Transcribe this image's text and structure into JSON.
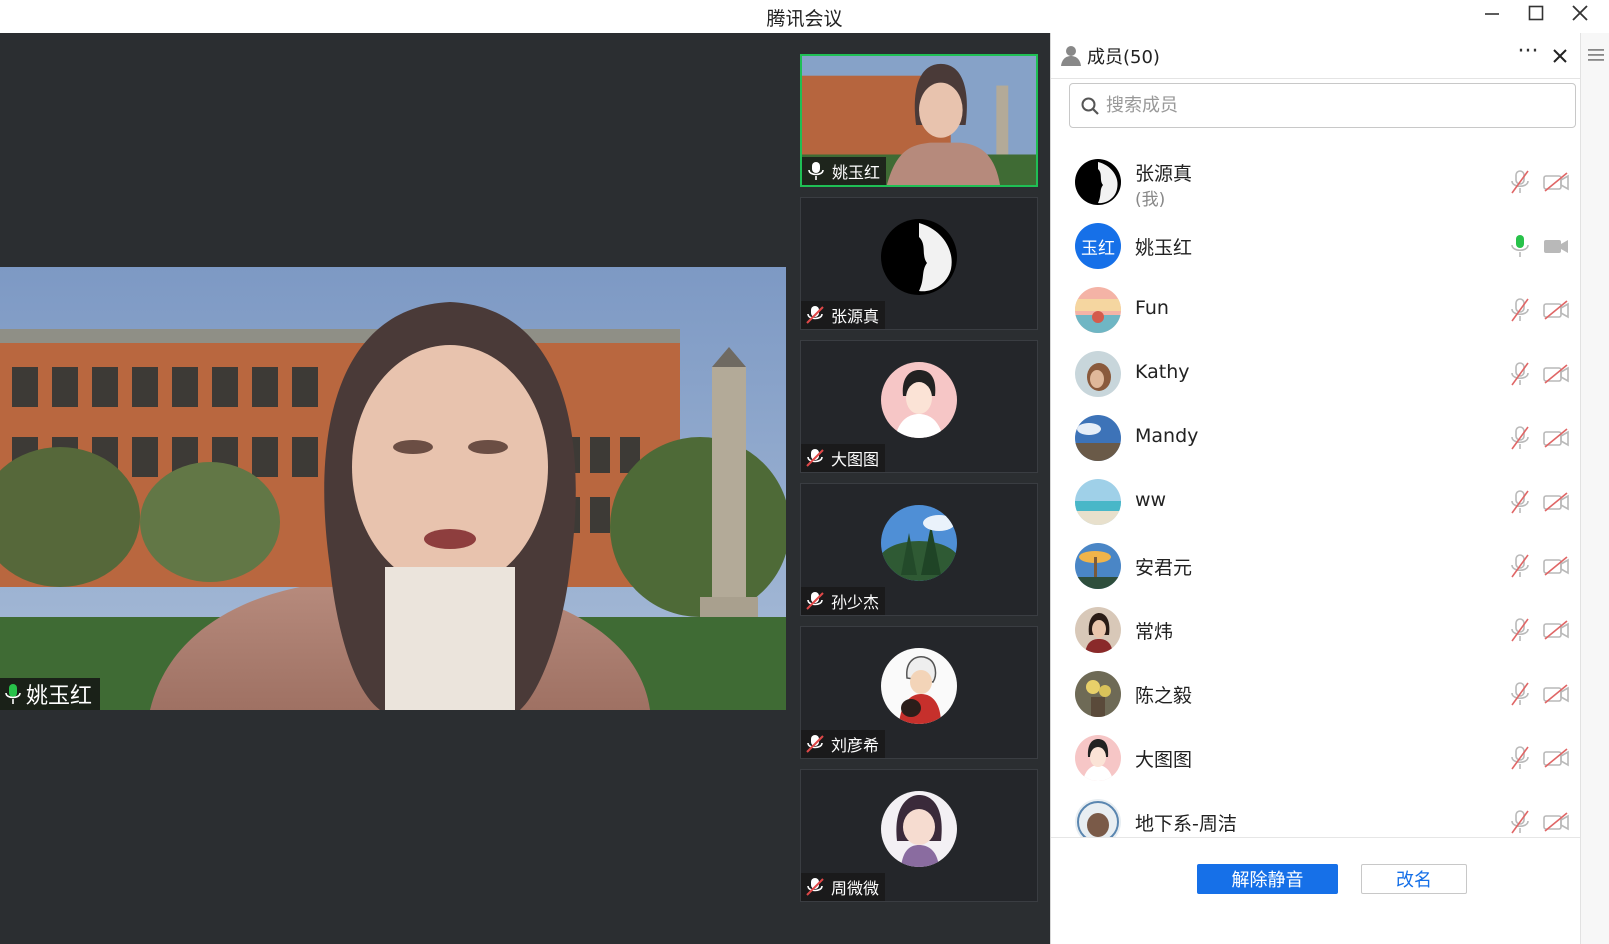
{
  "window": {
    "title": "腾讯会议"
  },
  "main_video": {
    "speaker_name": "姚玉红"
  },
  "thumbnails": [
    {
      "name": "姚玉红",
      "mic": "on",
      "active": true
    },
    {
      "name": "张源真",
      "mic": "muted"
    },
    {
      "name": "大图图",
      "mic": "muted"
    },
    {
      "name": "孙少杰",
      "mic": "muted"
    },
    {
      "name": "刘彦希",
      "mic": "muted"
    },
    {
      "name": "周微微",
      "mic": "muted"
    }
  ],
  "panel": {
    "title": "成员(50)",
    "more_label": "···",
    "search_placeholder": "搜索成员",
    "members": [
      {
        "name": "张源真",
        "sub": "(我)",
        "mic": "muted",
        "camera": "off"
      },
      {
        "name": "姚玉红",
        "avatar_text": "玉红",
        "mic": "on",
        "camera": "on"
      },
      {
        "name": "Fun",
        "mic": "muted",
        "camera": "off"
      },
      {
        "name": "Kathy",
        "mic": "muted",
        "camera": "off"
      },
      {
        "name": "Mandy",
        "mic": "muted",
        "camera": "off"
      },
      {
        "name": "ww",
        "mic": "muted",
        "camera": "off"
      },
      {
        "name": "安君元",
        "mic": "muted",
        "camera": "off"
      },
      {
        "name": "常炜",
        "mic": "muted",
        "camera": "off"
      },
      {
        "name": "陈之毅",
        "mic": "muted",
        "camera": "off"
      },
      {
        "name": "大图图",
        "mic": "muted",
        "camera": "off"
      },
      {
        "name": "地下系-周洁",
        "mic": "muted",
        "camera": "off"
      }
    ],
    "unmute_button": "解除静音",
    "rename_button": "改名"
  },
  "colors": {
    "accent": "#1670e8",
    "mic_on": "#28c24a",
    "muted_icon": "#b9b9b9",
    "active_border": "#1fbf55",
    "stage_bg": "#2b2e31"
  }
}
